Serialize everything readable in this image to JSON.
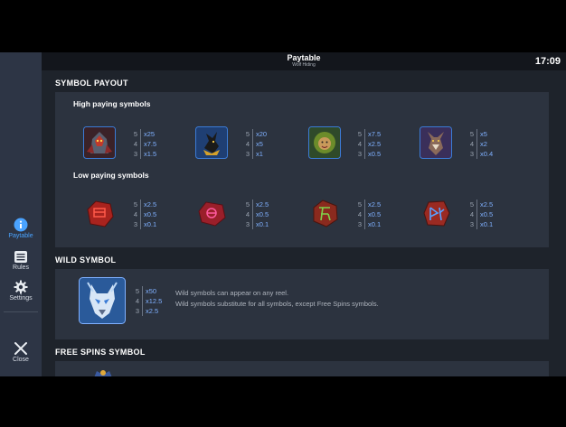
{
  "header": {
    "title": "Paytable",
    "subtitle": "Wolf Hiding",
    "clock": "17:09"
  },
  "sidebar": {
    "items": [
      {
        "label": "Paytable",
        "icon": "info-icon",
        "active": true
      },
      {
        "label": "Rules",
        "icon": "list-icon",
        "active": false
      },
      {
        "label": "Settings",
        "icon": "gear-icon",
        "active": false
      }
    ],
    "close_label": "Close"
  },
  "symbol_payout": {
    "title": "SYMBOL PAYOUT",
    "high_title": "High paying symbols",
    "low_title": "Low paying symbols",
    "high": [
      {
        "icon": "armored-warrior-symbol-icon",
        "payouts": [
          [
            "5",
            "x25"
          ],
          [
            "4",
            "x7.5"
          ],
          [
            "3",
            "x1.5"
          ]
        ]
      },
      {
        "icon": "anubis-jackal-symbol-icon",
        "payouts": [
          [
            "5",
            "x20"
          ],
          [
            "4",
            "x5"
          ],
          [
            "3",
            "x1"
          ]
        ]
      },
      {
        "icon": "green-lion-symbol-icon",
        "payouts": [
          [
            "5",
            "x7.5"
          ],
          [
            "4",
            "x2.5"
          ],
          [
            "3",
            "x0.5"
          ]
        ]
      },
      {
        "icon": "purple-werewolf-symbol-icon",
        "payouts": [
          [
            "5",
            "x5"
          ],
          [
            "4",
            "x2"
          ],
          [
            "3",
            "x0.4"
          ]
        ]
      }
    ],
    "low": [
      {
        "icon": "red-rune-stone-1-icon",
        "payouts": [
          [
            "5",
            "x2.5"
          ],
          [
            "4",
            "x0.5"
          ],
          [
            "3",
            "x0.1"
          ]
        ]
      },
      {
        "icon": "red-rune-stone-2-icon",
        "payouts": [
          [
            "5",
            "x2.5"
          ],
          [
            "4",
            "x0.5"
          ],
          [
            "3",
            "x0.1"
          ]
        ]
      },
      {
        "icon": "red-rune-stone-3-icon",
        "payouts": [
          [
            "5",
            "x2.5"
          ],
          [
            "4",
            "x0.5"
          ],
          [
            "3",
            "x0.1"
          ]
        ]
      },
      {
        "icon": "red-rune-stone-4-icon",
        "payouts": [
          [
            "5",
            "x2.5"
          ],
          [
            "4",
            "x0.5"
          ],
          [
            "3",
            "x0.1"
          ]
        ]
      }
    ]
  },
  "wild": {
    "title": "WILD SYMBOL",
    "icon": "ice-wolf-wild-icon",
    "payouts": [
      [
        "5",
        "x50"
      ],
      [
        "4",
        "x12.5"
      ],
      [
        "3",
        "x2.5"
      ]
    ],
    "line1": "Wild symbols can appear on any reel.",
    "line2": "Wild symbols substitute for all symbols, except Free Spins symbols."
  },
  "free_spins": {
    "title": "FREE SPINS SYMBOL"
  },
  "colors": {
    "accent": "#4aa3ff",
    "payout_value": "#7fb0ff",
    "panel": "#2c333f",
    "background": "#1e232b",
    "sidebar": "#2d3545"
  }
}
